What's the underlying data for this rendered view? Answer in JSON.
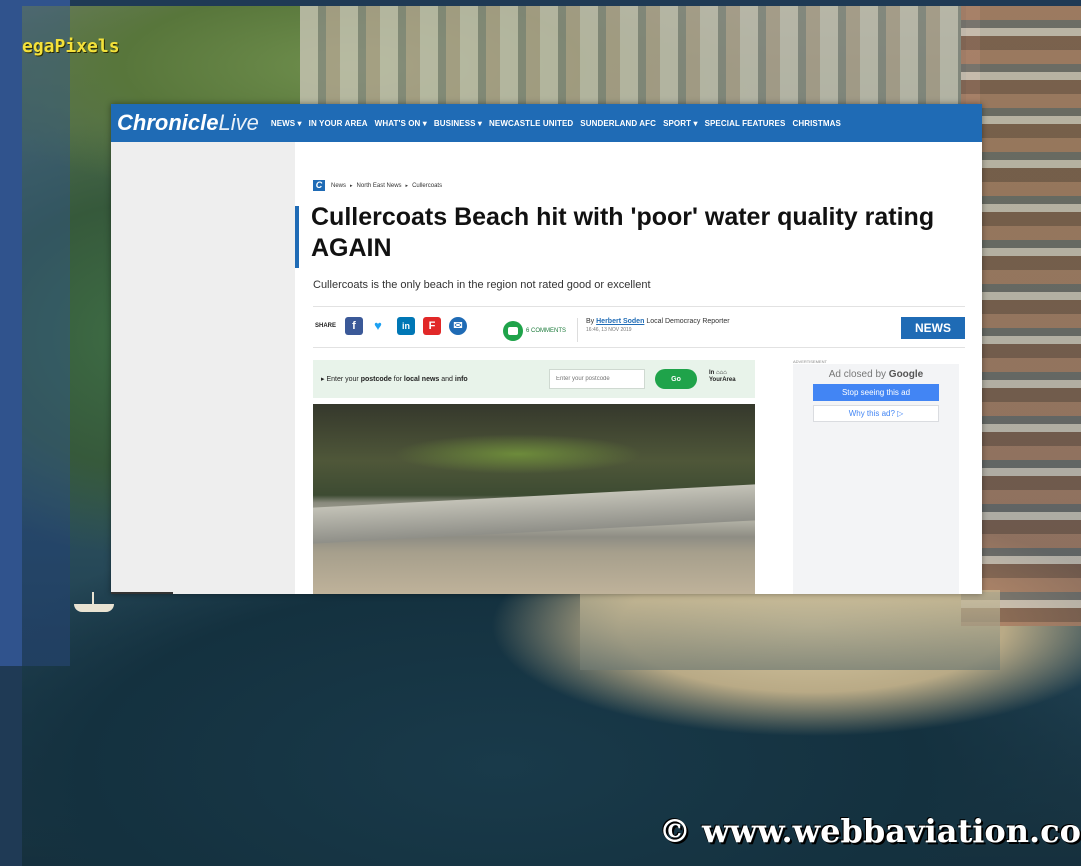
{
  "watermark": {
    "badge": "egaPixels",
    "copyright": "© www.webbaviation.co"
  },
  "site": {
    "brand_bold": "Chronicle",
    "brand_light": "Live",
    "nav": [
      "NEWS ▾",
      "IN YOUR AREA",
      "WHAT'S ON ▾",
      "BUSINESS ▾",
      "NEWCASTLE UNITED",
      "SUNDERLAND AFC",
      "SPORT ▾",
      "SPECIAL FEATURES",
      "CHRISTMAS"
    ]
  },
  "breadcrumb": {
    "logo": "C",
    "items": [
      "News",
      "North East News",
      "Cullercoats"
    ]
  },
  "article": {
    "title": "Cullercoats Beach hit with 'poor' water quality rating AGAIN",
    "subtitle": "Cullercoats is the only beach in the region not rated good or excellent",
    "share_label": "SHARE",
    "comments": "6 COMMENTS",
    "byline_prefix": "By",
    "author": "Herbert Soden",
    "author_role": "Local Democracy Reporter",
    "timestamp": "16:46, 13 NOV 2019",
    "section_tag": "NEWS"
  },
  "share_icons": [
    {
      "icon": "facebook-icon",
      "glyph": "f",
      "color": "#3b5998"
    },
    {
      "icon": "twitter-icon",
      "glyph": "🐦",
      "color": "#1da1f2"
    },
    {
      "icon": "linkedin-icon",
      "glyph": "in",
      "color": "#0077b5"
    },
    {
      "icon": "flipboard-icon",
      "glyph": "F",
      "color": "#e12828"
    },
    {
      "icon": "email-icon",
      "glyph": "✉",
      "color": "#1f6bb5"
    }
  ],
  "postcode": {
    "prompt_pre": "▸ Enter your ",
    "prompt_bold1": "postcode",
    "prompt_mid": " for ",
    "prompt_bold2": "local news",
    "prompt_and": " and ",
    "prompt_bold3": "info",
    "placeholder": "Enter your postcode",
    "button": "Go",
    "brand_line1": "In ⌂⌂⌂",
    "brand_line2": "YourArea"
  },
  "ad": {
    "label": "ADVERTISEMENT",
    "closed_text": "Ad closed by",
    "closed_brand": "Google",
    "stop": "Stop seeing this ad",
    "why": "Why this ad? ▷"
  }
}
